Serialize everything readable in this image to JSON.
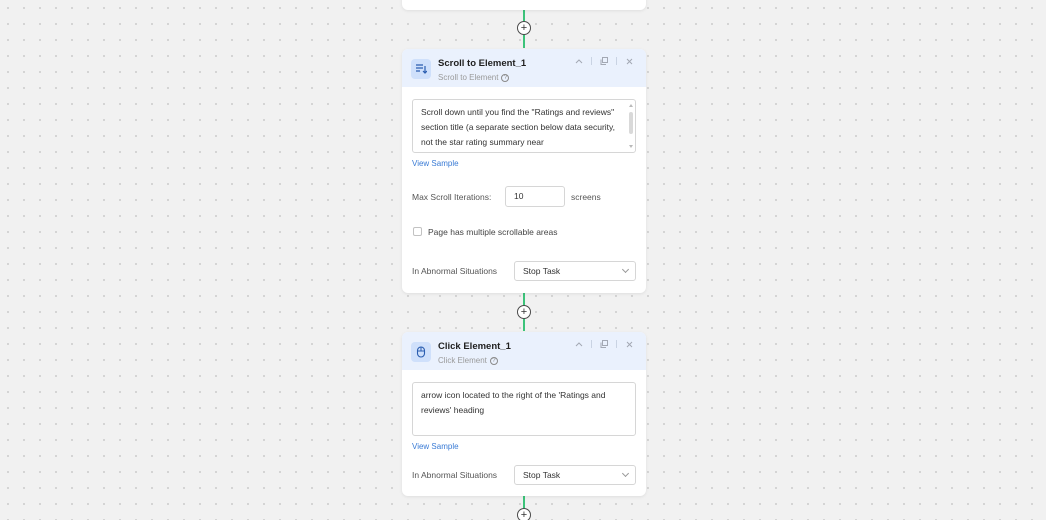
{
  "colors": {
    "connector": "#3cc37a",
    "header_bg": "#eaf1fd",
    "link": "#3a7bd5"
  },
  "scroll_node": {
    "title": "Scroll to Element_1",
    "subtitle": "Scroll to Element",
    "icon": "scroll-down-icon",
    "description": "Scroll down until you find the \"Ratings and reviews\" section title (a separate section below data security, not the star rating summary near",
    "view_sample": "View Sample",
    "max_scroll_label": "Max Scroll Iterations:",
    "max_scroll_value": "10",
    "max_scroll_unit": "screens",
    "multiple_scroll_label": "Page has multiple scrollable areas",
    "abnormal_label": "In Abnormal Situations",
    "abnormal_value": "Stop Task"
  },
  "click_node": {
    "title": "Click Element_1",
    "subtitle": "Click Element",
    "icon": "mouse-icon",
    "description": "arrow icon located to the right of the 'Ratings and reviews' heading",
    "view_sample": "View Sample",
    "abnormal_label": "In Abnormal Situations",
    "abnormal_value": "Stop Task"
  },
  "add_step_symbol": "+",
  "help_symbol": "?"
}
